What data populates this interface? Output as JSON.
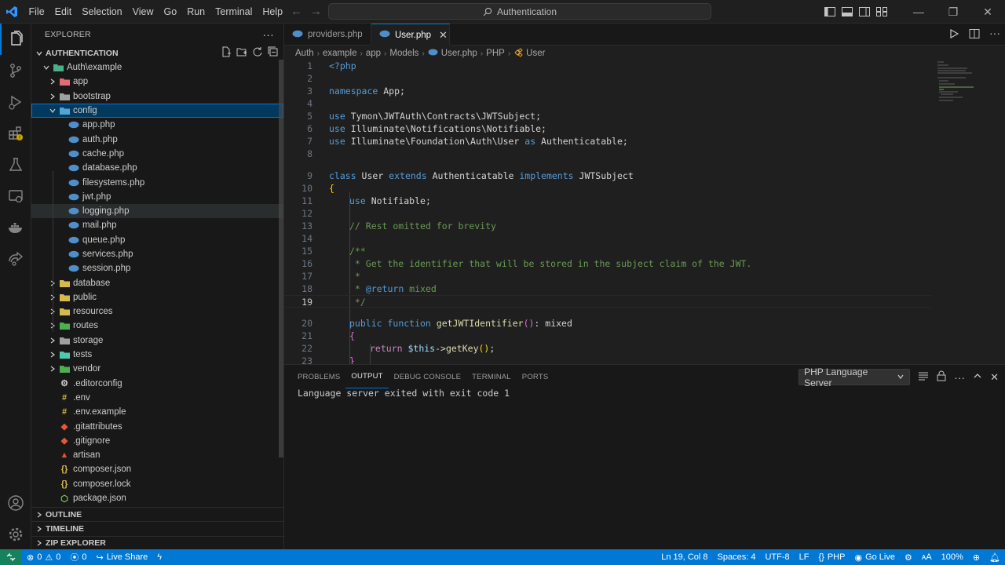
{
  "menu": [
    "File",
    "Edit",
    "Selection",
    "View",
    "Go",
    "Run",
    "Terminal",
    "Help"
  ],
  "title": {
    "search_text": "Authentication"
  },
  "explorer": {
    "title": "EXPLORER",
    "section": "AUTHENTICATION",
    "root": "Auth\\example",
    "folders_top": [
      {
        "name": "app",
        "color": "#e06c75",
        "expanded": false
      },
      {
        "name": "bootstrap",
        "color": "#a0a0a0",
        "expanded": false
      },
      {
        "name": "config",
        "color": "#4fa5d6",
        "expanded": true
      }
    ],
    "config_files": [
      "app.php",
      "auth.php",
      "cache.php",
      "database.php",
      "filesystems.php",
      "jwt.php",
      "logging.php",
      "mail.php",
      "queue.php",
      "services.php",
      "session.php"
    ],
    "folders_bottom": [
      {
        "name": "database",
        "color": "#d6b94f"
      },
      {
        "name": "public",
        "color": "#d6b94f"
      },
      {
        "name": "resources",
        "color": "#d6b94f"
      },
      {
        "name": "routes",
        "color": "#4caf50"
      },
      {
        "name": "storage",
        "color": "#a0a0a0"
      },
      {
        "name": "tests",
        "color": "#4ec9b0"
      },
      {
        "name": "vendor",
        "color": "#4caf50"
      }
    ],
    "root_files": [
      {
        "name": ".editorconfig",
        "icon": "editorconfig-icon",
        "glyph": "⚙",
        "color": "#cccccc"
      },
      {
        "name": ".env",
        "icon": "env-icon",
        "glyph": "#",
        "color": "#d6b94f"
      },
      {
        "name": ".env.example",
        "icon": "env-icon",
        "glyph": "#",
        "color": "#d6b94f"
      },
      {
        "name": ".gitattributes",
        "icon": "git-icon",
        "glyph": "◆",
        "color": "#e05a3a"
      },
      {
        "name": ".gitignore",
        "icon": "git-icon",
        "glyph": "◆",
        "color": "#e05a3a"
      },
      {
        "name": "artisan",
        "icon": "laravel-icon",
        "glyph": "▲",
        "color": "#e0503a"
      },
      {
        "name": "composer.json",
        "icon": "braces-icon",
        "glyph": "{}",
        "color": "#d6b94f"
      },
      {
        "name": "composer.lock",
        "icon": "braces-icon",
        "glyph": "{}",
        "color": "#d6b94f"
      },
      {
        "name": "package.json",
        "icon": "node-icon",
        "glyph": "⬡",
        "color": "#8cc84b"
      }
    ],
    "bottom_sections": [
      "OUTLINE",
      "TIMELINE",
      "ZIP EXPLORER"
    ]
  },
  "tabs": [
    {
      "label": "providers.php",
      "active": false
    },
    {
      "label": "User.php",
      "active": true
    }
  ],
  "breadcrumb": [
    "Auth",
    "example",
    "app",
    "Models",
    "User.php",
    "PHP",
    "User"
  ],
  "panel": {
    "tabs": [
      "PROBLEMS",
      "OUTPUT",
      "DEBUG CONSOLE",
      "TERMINAL",
      "PORTS"
    ],
    "active_tab": "OUTPUT",
    "channel": "PHP Language Server",
    "output": "Language server exited with exit code 1"
  },
  "status": {
    "errors": "0",
    "warnings": "0",
    "ports": "0",
    "live_share": "Live Share",
    "position": "Ln 19, Col 8",
    "spaces": "Spaces: 4",
    "encoding": "UTF-8",
    "eol": "LF",
    "language": "PHP",
    "go_live": "Go Live",
    "zoom": "100%"
  },
  "code": {
    "l1": "<?php",
    "l3_kw": "namespace",
    "l3_rest": " App;",
    "l5_kw": "use",
    "l5_rest": " Tymon\\JWTAuth\\Contracts\\JWTSubject;",
    "l6_kw": "use",
    "l6_rest": " Illuminate\\Notifications\\Notifiable;",
    "l7_kw": "use",
    "l7_a": " Illuminate\\Foundation\\Auth\\User ",
    "l7_as": "as",
    "l7_b": " Authenticatable;",
    "l9_class": "class",
    "l9_name": " User ",
    "l9_ext": "extends",
    "l9_parent": " Authenticatable ",
    "l9_impl": "implements",
    "l9_iface": " JWTSubject",
    "l10": "{",
    "l11_kw": "use",
    "l11_rest": " Notifiable;",
    "l13": "// Rest omitted for brevity",
    "l15": "/**",
    "l16": " * Get the identifier that will be stored in the subject claim of the JWT.",
    "l17": " *",
    "l18_a": " * ",
    "l18_tag": "@return",
    "l18_b": " mixed",
    "l19": " */",
    "l20_pub": "public",
    "l20_fn": " function",
    "l20_name": " getJWTIdentifier",
    "l20_p": "()",
    "l20_ret": ": mixed",
    "l21": "{",
    "l22_ret": "return",
    "l22_this": " $this",
    "l22_arrow": "->",
    "l22_call": "getKey",
    "l22_p": "()",
    "l22_semi": ";",
    "l23": "}"
  },
  "line_numbers": [
    "1",
    "2",
    "3",
    "4",
    "5",
    "6",
    "7",
    "8",
    "9",
    "10",
    "11",
    "12",
    "13",
    "14",
    "15",
    "16",
    "17",
    "18",
    "19",
    "20",
    "21",
    "22",
    "23"
  ]
}
